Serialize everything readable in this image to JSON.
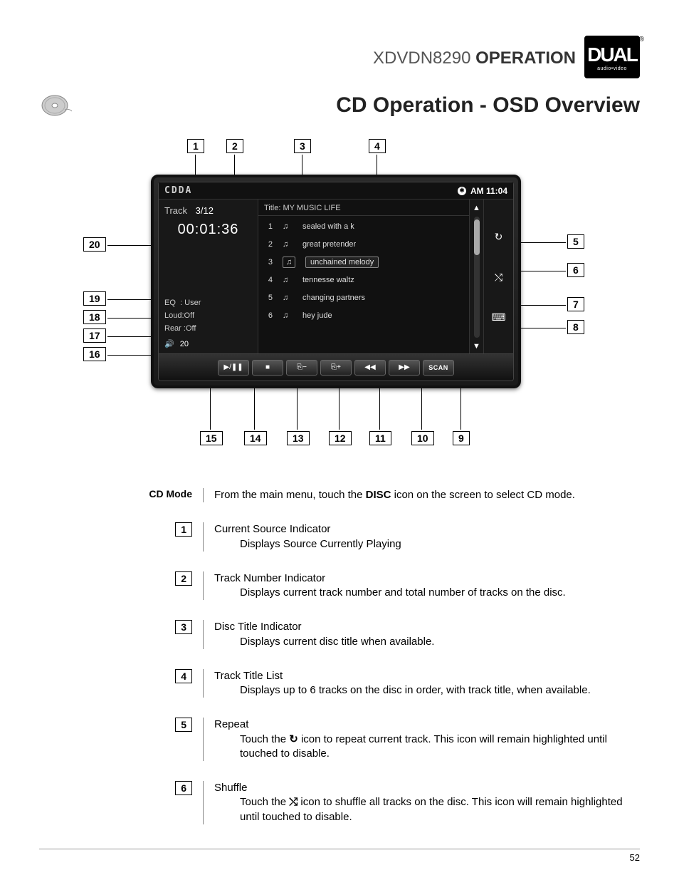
{
  "header": {
    "model": "XDVDN8290",
    "operation": "OPERATION",
    "brand": "DUAL",
    "brand_sub": "audio•video"
  },
  "title": "CD Operation - OSD Overview",
  "osd": {
    "source": "CDDA",
    "clock": "AM 11:04",
    "track_label": "Track",
    "track_value": "3/12",
    "time": "00:01:36",
    "title_label": "Title:",
    "title_value": "MY  MUSIC LIFE",
    "eq_label": "EQ",
    "eq_value": ": User",
    "loud_label": "Loud:",
    "loud_value": "Off",
    "rear_label": "Rear :",
    "rear_value": "Off",
    "vol": "20",
    "tracks": [
      {
        "n": "1",
        "name": "sealed with a k"
      },
      {
        "n": "2",
        "name": "great pretender"
      },
      {
        "n": "3",
        "name": "unchained melody"
      },
      {
        "n": "4",
        "name": "tennesse waltz"
      },
      {
        "n": "5",
        "name": "changing partners"
      },
      {
        "n": "6",
        "name": "hey jude"
      }
    ],
    "buttons": {
      "scan": "SCAN"
    }
  },
  "callouts_top": [
    "1",
    "2",
    "3",
    "4"
  ],
  "callouts_right": [
    "5",
    "6",
    "7",
    "8"
  ],
  "callouts_left_upper": [
    "20"
  ],
  "callouts_left_lower": [
    "19",
    "18",
    "17",
    "16"
  ],
  "callouts_bottom": [
    "15",
    "14",
    "13",
    "12",
    "11",
    "10",
    "9"
  ],
  "desc_intro_label": "CD Mode",
  "desc_intro_text_a": "From the main menu, touch the ",
  "desc_intro_text_b": "DISC",
  "desc_intro_text_c": " icon on the screen to select CD mode.",
  "descriptions": [
    {
      "num": "1",
      "heading": "Current Source Indicator",
      "sub": "Displays Source Currently Playing"
    },
    {
      "num": "2",
      "heading": "Track Number Indicator",
      "sub": "Displays current track number and total number of tracks on the disc."
    },
    {
      "num": "3",
      "heading": "Disc Title Indicator",
      "sub": "Displays current disc title when available."
    },
    {
      "num": "4",
      "heading": "Track Title List",
      "sub": "Displays up to 6 tracks on the disc in order, with track title, when available."
    },
    {
      "num": "5",
      "heading": "Repeat",
      "sub_pre": "Touch the ",
      "icon": "repeat",
      "sub_post": " icon to repeat current track. This icon will remain highlighted until touched to disable."
    },
    {
      "num": "6",
      "heading": "Shuffle",
      "sub_pre": "Touch the ",
      "icon": "shuffle",
      "sub_post": " icon to shuffle all tracks on the disc. This icon will remain highlighted until touched to disable."
    }
  ],
  "page_number": "52"
}
